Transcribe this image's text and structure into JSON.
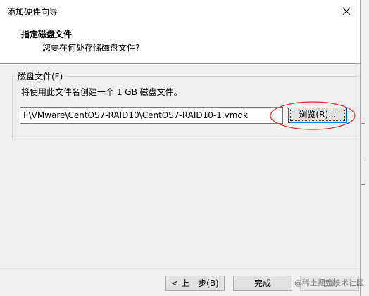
{
  "dialog": {
    "title": "添加硬件向导",
    "close_glyph": "✕"
  },
  "header": {
    "title": "指定磁盘文件",
    "subtitle": "您要在何处存储磁盘文件?"
  },
  "disk_file": {
    "group_label": "磁盘文件(F)",
    "description": "将使用此文件名创建一个 1 GB 磁盘文件。",
    "path_value": "I:\\VMware\\CentOS7-RAID10\\CentOS7-RAID10-1.vmdk",
    "browse_label": "浏览(R)..."
  },
  "footer": {
    "back_label": "< 上一步(B)",
    "finish_label": "完成",
    "cancel_label": "取消"
  },
  "watermark": "@稀土掘金技术社区",
  "colors": {
    "annotation": "#e03030",
    "focus": "#0078d7"
  }
}
